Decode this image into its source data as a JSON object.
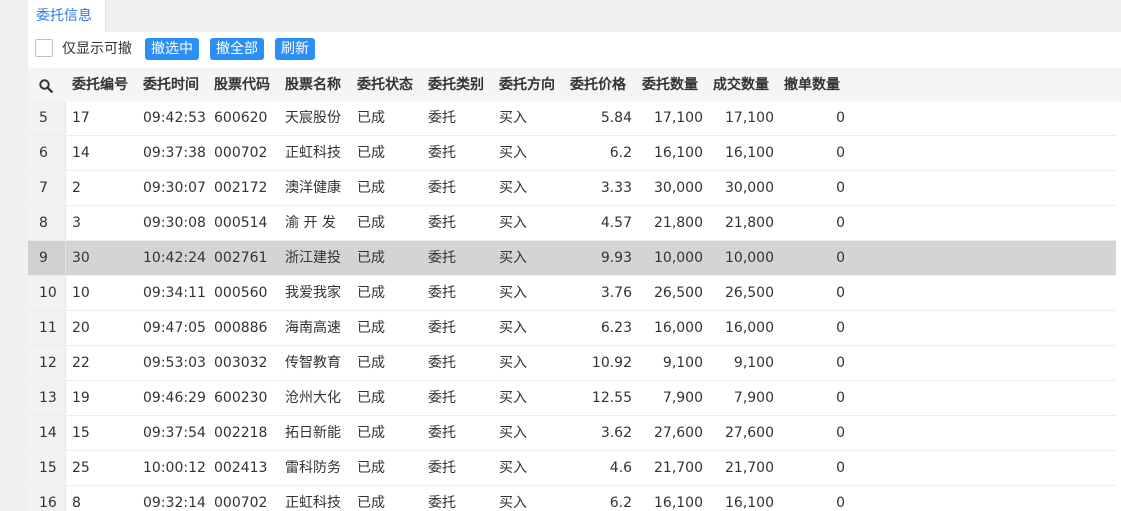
{
  "tab": {
    "label": "委托信息"
  },
  "toolbar": {
    "checkbox_label": "仅显示可撤",
    "cancel_selected": "撤选中",
    "cancel_all": "撤全部",
    "refresh": "刷新"
  },
  "columns": [
    "委托编号",
    "委托时间",
    "股票代码",
    "股票名称",
    "委托状态",
    "委托类别",
    "委托方向",
    "委托价格",
    "委托数量",
    "成交数量",
    "撤单数量"
  ],
  "rows": [
    {
      "idx": "5",
      "id": "17",
      "time": "09:42:53",
      "code": "600620",
      "name": "天宸股份",
      "status": "已成",
      "category": "委托",
      "direction": "买入",
      "price": "5.84",
      "qty": "17,100",
      "filled": "17,100",
      "cancelled": "0"
    },
    {
      "idx": "6",
      "id": "14",
      "time": "09:37:38",
      "code": "000702",
      "name": "正虹科技",
      "status": "已成",
      "category": "委托",
      "direction": "买入",
      "price": "6.2",
      "qty": "16,100",
      "filled": "16,100",
      "cancelled": "0"
    },
    {
      "idx": "7",
      "id": "2",
      "time": "09:30:07",
      "code": "002172",
      "name": "澳洋健康",
      "status": "已成",
      "category": "委托",
      "direction": "买入",
      "price": "3.33",
      "qty": "30,000",
      "filled": "30,000",
      "cancelled": "0"
    },
    {
      "idx": "8",
      "id": "3",
      "time": "09:30:08",
      "code": "000514",
      "name": "渝 开 发",
      "status": "已成",
      "category": "委托",
      "direction": "买入",
      "price": "4.57",
      "qty": "21,800",
      "filled": "21,800",
      "cancelled": "0"
    },
    {
      "idx": "9",
      "id": "30",
      "time": "10:42:24",
      "code": "002761",
      "name": "浙江建投",
      "status": "已成",
      "category": "委托",
      "direction": "买入",
      "price": "9.93",
      "qty": "10,000",
      "filled": "10,000",
      "cancelled": "0"
    },
    {
      "idx": "10",
      "id": "10",
      "time": "09:34:11",
      "code": "000560",
      "name": "我爱我家",
      "status": "已成",
      "category": "委托",
      "direction": "买入",
      "price": "3.76",
      "qty": "26,500",
      "filled": "26,500",
      "cancelled": "0"
    },
    {
      "idx": "11",
      "id": "20",
      "time": "09:47:05",
      "code": "000886",
      "name": "海南高速",
      "status": "已成",
      "category": "委托",
      "direction": "买入",
      "price": "6.23",
      "qty": "16,000",
      "filled": "16,000",
      "cancelled": "0"
    },
    {
      "idx": "12",
      "id": "22",
      "time": "09:53:03",
      "code": "003032",
      "name": "传智教育",
      "status": "已成",
      "category": "委托",
      "direction": "买入",
      "price": "10.92",
      "qty": "9,100",
      "filled": "9,100",
      "cancelled": "0"
    },
    {
      "idx": "13",
      "id": "19",
      "time": "09:46:29",
      "code": "600230",
      "name": "沧州大化",
      "status": "已成",
      "category": "委托",
      "direction": "买入",
      "price": "12.55",
      "qty": "7,900",
      "filled": "7,900",
      "cancelled": "0"
    },
    {
      "idx": "14",
      "id": "15",
      "time": "09:37:54",
      "code": "002218",
      "name": "拓日新能",
      "status": "已成",
      "category": "委托",
      "direction": "买入",
      "price": "3.62",
      "qty": "27,600",
      "filled": "27,600",
      "cancelled": "0"
    },
    {
      "idx": "15",
      "id": "25",
      "time": "10:00:12",
      "code": "002413",
      "name": "雷科防务",
      "status": "已成",
      "category": "委托",
      "direction": "买入",
      "price": "4.6",
      "qty": "21,700",
      "filled": "21,700",
      "cancelled": "0"
    },
    {
      "idx": "16",
      "id": "8",
      "time": "09:32:14",
      "code": "000702",
      "name": "正虹科技",
      "status": "已成",
      "category": "委托",
      "direction": "买入",
      "price": "6.2",
      "qty": "16,100",
      "filled": "16,100",
      "cancelled": "0"
    }
  ],
  "selected_row_index": 4,
  "colors": {
    "accent": "#2b8ff5",
    "tab_text": "#2a7be4",
    "selected_row": "#d4d4d4"
  }
}
